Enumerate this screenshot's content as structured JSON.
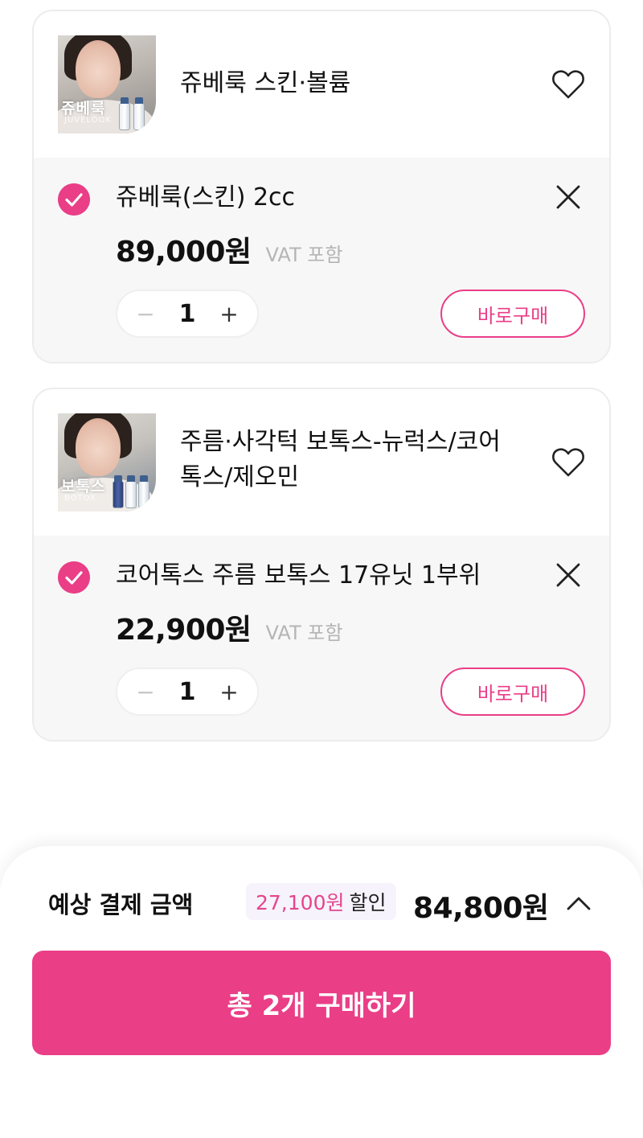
{
  "cart": {
    "items": [
      {
        "product_title": "쥬베룩 스킨·볼륨",
        "thumb_brand": "쥬베룩",
        "thumb_brand_en": "JUVELOOK",
        "option_name": "쥬베룩(스킨) 2cc",
        "price": "89,000원",
        "vat": "VAT 포함",
        "quantity": "1",
        "minus": "−",
        "plus": "+",
        "buy_now": "바로구매"
      },
      {
        "product_title": "주름·사각턱 보톡스-뉴럭스/코어톡스/제오민",
        "thumb_brand": "보톡스",
        "thumb_brand_en": "BOTOX",
        "option_name": "코어톡스 주름 보톡스 17유닛 1부위",
        "price": "22,900원",
        "vat": "VAT 포함",
        "quantity": "1",
        "minus": "−",
        "plus": "+",
        "buy_now": "바로구매"
      }
    ]
  },
  "summary": {
    "label": "예상 결제 금액",
    "discount_amount": "27,100원",
    "discount_word": "할인",
    "total": "84,800원"
  },
  "purchase_button": "총 2개 구매하기",
  "colors": {
    "accent": "#ea3e87",
    "card_body_bg": "#f7f7f7",
    "discount_bg": "#f6f3fc"
  },
  "icons": {
    "wishlist": "heart-outline-icon",
    "selected": "check-circle-icon",
    "remove": "close-icon",
    "expand": "chevron-up-icon"
  }
}
